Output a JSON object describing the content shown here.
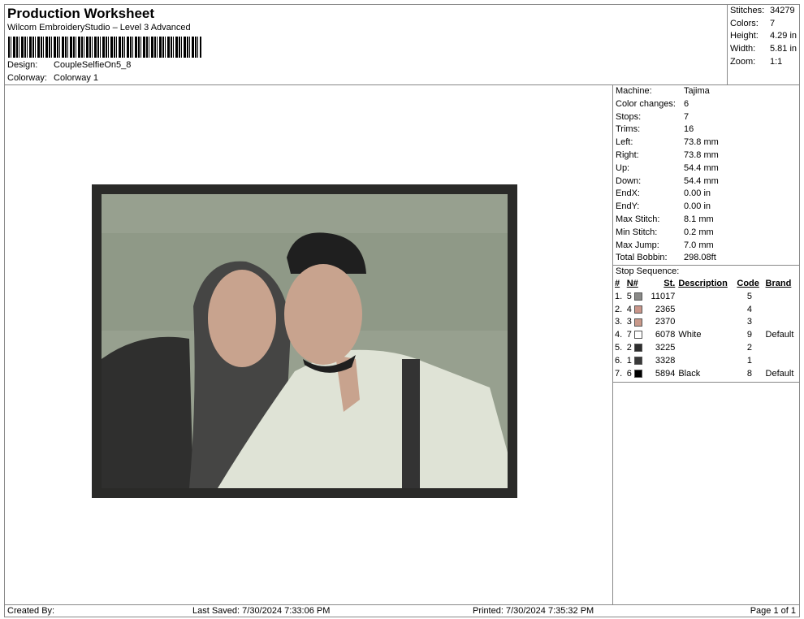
{
  "header": {
    "title": "Production Worksheet",
    "subtitle": "Wilcom EmbroideryStudio – Level 3 Advanced",
    "design_label": "Design:",
    "design_value": "CoupleSelfieOn5_8",
    "colorway_label": "Colorway:",
    "colorway_value": "Colorway 1"
  },
  "stats": [
    {
      "k": "Stitches:",
      "v": "34279"
    },
    {
      "k": "Colors:",
      "v": "7"
    },
    {
      "k": "Height:",
      "v": "4.29 in"
    },
    {
      "k": "Width:",
      "v": "5.81 in"
    },
    {
      "k": "Zoom:",
      "v": "1:1"
    }
  ],
  "machine": [
    {
      "k": "Machine:",
      "v": "Tajima"
    },
    {
      "k": "Color changes:",
      "v": "6"
    },
    {
      "k": "Stops:",
      "v": "7"
    },
    {
      "k": "Trims:",
      "v": "16"
    },
    {
      "k": "Left:",
      "v": "73.8 mm"
    },
    {
      "k": "Right:",
      "v": "73.8 mm"
    },
    {
      "k": "Up:",
      "v": "54.4 mm"
    },
    {
      "k": "Down:",
      "v": "54.4 mm"
    },
    {
      "k": "EndX:",
      "v": "0.00 in"
    },
    {
      "k": "EndY:",
      "v": "0.00 in"
    },
    {
      "k": "Max Stitch:",
      "v": "8.1 mm"
    },
    {
      "k": "Min Stitch:",
      "v": "0.2 mm"
    },
    {
      "k": "Max Jump:",
      "v": "7.0 mm"
    },
    {
      "k": "Total Bobbin:",
      "v": "298.08ft"
    }
  ],
  "stop_sequence": {
    "title": "Stop Sequence:",
    "headers": [
      "#",
      "N#",
      "St.",
      "Description",
      "Code",
      "Brand"
    ],
    "rows": [
      {
        "i": "1.",
        "n": "5",
        "color": "#8a8a88",
        "st": "11017",
        "desc": "",
        "code": "5",
        "brand": ""
      },
      {
        "i": "2.",
        "n": "4",
        "color": "#c9968a",
        "st": "2365",
        "desc": "",
        "code": "4",
        "brand": ""
      },
      {
        "i": "3.",
        "n": "3",
        "color": "#c9998a",
        "st": "2370",
        "desc": "",
        "code": "3",
        "brand": ""
      },
      {
        "i": "4.",
        "n": "7",
        "color": "#ffffff",
        "st": "6078",
        "desc": "White",
        "code": "9",
        "brand": "Default"
      },
      {
        "i": "5.",
        "n": "2",
        "color": "#2e2e2e",
        "st": "3225",
        "desc": "",
        "code": "2",
        "brand": ""
      },
      {
        "i": "6.",
        "n": "1",
        "color": "#3a3a3a",
        "st": "3328",
        "desc": "",
        "code": "1",
        "brand": ""
      },
      {
        "i": "7.",
        "n": "6",
        "color": "#000000",
        "st": "5894",
        "desc": "Black",
        "code": "8",
        "brand": "Default"
      }
    ]
  },
  "footer": {
    "created": "Created By:",
    "saved": "Last Saved: 7/30/2024 7:33:06 PM",
    "printed": "Printed: 7/30/2024 7:35:32 PM",
    "page": "Page 1 of 1"
  }
}
